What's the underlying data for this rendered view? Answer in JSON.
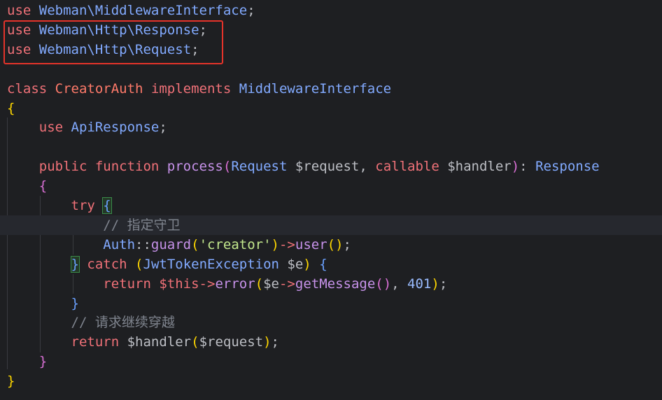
{
  "editor": {
    "lines": [
      {
        "segments": [
          {
            "t": "use ",
            "c": "kw"
          },
          {
            "t": "Webman\\MiddlewareInterface",
            "c": "ns"
          },
          {
            "t": ";",
            "c": "punct"
          }
        ]
      },
      {
        "segments": [
          {
            "t": "use ",
            "c": "kw"
          },
          {
            "t": "Webman\\Http\\Response",
            "c": "ns"
          },
          {
            "t": ";",
            "c": "punct"
          }
        ]
      },
      {
        "segments": [
          {
            "t": "use ",
            "c": "kw"
          },
          {
            "t": "Webman\\Http\\Request",
            "c": "ns"
          },
          {
            "t": ";",
            "c": "punct"
          }
        ]
      },
      {
        "segments": []
      },
      {
        "segments": [
          {
            "t": "class ",
            "c": "kw"
          },
          {
            "t": "CreatorAuth ",
            "c": "kw2"
          },
          {
            "t": "implements ",
            "c": "kw"
          },
          {
            "t": "MiddlewareInterface",
            "c": "ns"
          }
        ]
      },
      {
        "segments": [
          {
            "t": "{",
            "c": "brace-y"
          }
        ]
      },
      {
        "segments": [
          {
            "t": "    use ",
            "c": "kw"
          },
          {
            "t": "ApiResponse",
            "c": "ns"
          },
          {
            "t": ";",
            "c": "punct"
          }
        ]
      },
      {
        "segments": []
      },
      {
        "segments": [
          {
            "t": "    public ",
            "c": "kw"
          },
          {
            "t": "function ",
            "c": "kw"
          },
          {
            "t": "process",
            "c": "fn"
          },
          {
            "t": "(",
            "c": "paren"
          },
          {
            "t": "Request ",
            "c": "ns"
          },
          {
            "t": "$request",
            "c": "var"
          },
          {
            "t": ", ",
            "c": "punct"
          },
          {
            "t": "callable ",
            "c": "kw"
          },
          {
            "t": "$handler",
            "c": "var"
          },
          {
            "t": ")",
            "c": "paren"
          },
          {
            "t": ": ",
            "c": "punct"
          },
          {
            "t": "Response",
            "c": "ns"
          }
        ]
      },
      {
        "segments": [
          {
            "t": "    {",
            "c": "brace-p"
          }
        ]
      },
      {
        "segments": [
          {
            "t": "        try ",
            "c": "kw"
          },
          {
            "t": "{",
            "c": "brace-b",
            "match": true
          }
        ]
      },
      {
        "segments": [
          {
            "t": "            // 指定守卫",
            "c": "cmt"
          }
        ],
        "current": true
      },
      {
        "segments": [
          {
            "t": "            Auth",
            "c": "ns"
          },
          {
            "t": "::",
            "c": "punct"
          },
          {
            "t": "guard",
            "c": "fn"
          },
          {
            "t": "(",
            "c": "paren2"
          },
          {
            "t": "'creator'",
            "c": "str"
          },
          {
            "t": ")",
            "c": "paren2"
          },
          {
            "t": "->",
            "c": "kw"
          },
          {
            "t": "user",
            "c": "fn"
          },
          {
            "t": "()",
            "c": "paren2"
          },
          {
            "t": ";",
            "c": "punct"
          }
        ]
      },
      {
        "segments": [
          {
            "t": "        ",
            "c": "punct"
          },
          {
            "t": "}",
            "c": "brace-b",
            "match": true
          },
          {
            "t": " catch ",
            "c": "kw"
          },
          {
            "t": "(",
            "c": "paren2"
          },
          {
            "t": "JwtTokenException ",
            "c": "ns"
          },
          {
            "t": "$e",
            "c": "var"
          },
          {
            "t": ") ",
            "c": "paren2"
          },
          {
            "t": "{",
            "c": "brace-b"
          }
        ]
      },
      {
        "segments": [
          {
            "t": "            return ",
            "c": "kw"
          },
          {
            "t": "$this",
            "c": "kw"
          },
          {
            "t": "->",
            "c": "kw"
          },
          {
            "t": "error",
            "c": "fn"
          },
          {
            "t": "(",
            "c": "paren2"
          },
          {
            "t": "$e",
            "c": "var"
          },
          {
            "t": "->",
            "c": "kw"
          },
          {
            "t": "getMessage",
            "c": "fn"
          },
          {
            "t": "()",
            "c": "paren"
          },
          {
            "t": ", ",
            "c": "punct"
          },
          {
            "t": "401",
            "c": "num"
          },
          {
            "t": ")",
            "c": "paren2"
          },
          {
            "t": ";",
            "c": "punct"
          }
        ]
      },
      {
        "segments": [
          {
            "t": "        }",
            "c": "brace-b"
          }
        ]
      },
      {
        "segments": [
          {
            "t": "        // 请求继续穿越",
            "c": "cmt"
          }
        ]
      },
      {
        "segments": [
          {
            "t": "        return ",
            "c": "kw"
          },
          {
            "t": "$handler",
            "c": "var"
          },
          {
            "t": "(",
            "c": "paren2"
          },
          {
            "t": "$request",
            "c": "var"
          },
          {
            "t": ")",
            "c": "paren2"
          },
          {
            "t": ";",
            "c": "punct"
          }
        ]
      },
      {
        "segments": [
          {
            "t": "    }",
            "c": "brace-p"
          }
        ]
      },
      {
        "segments": [
          {
            "t": "}",
            "c": "brace-y"
          }
        ]
      }
    ]
  },
  "annotation": {
    "color": "#e5332a"
  }
}
